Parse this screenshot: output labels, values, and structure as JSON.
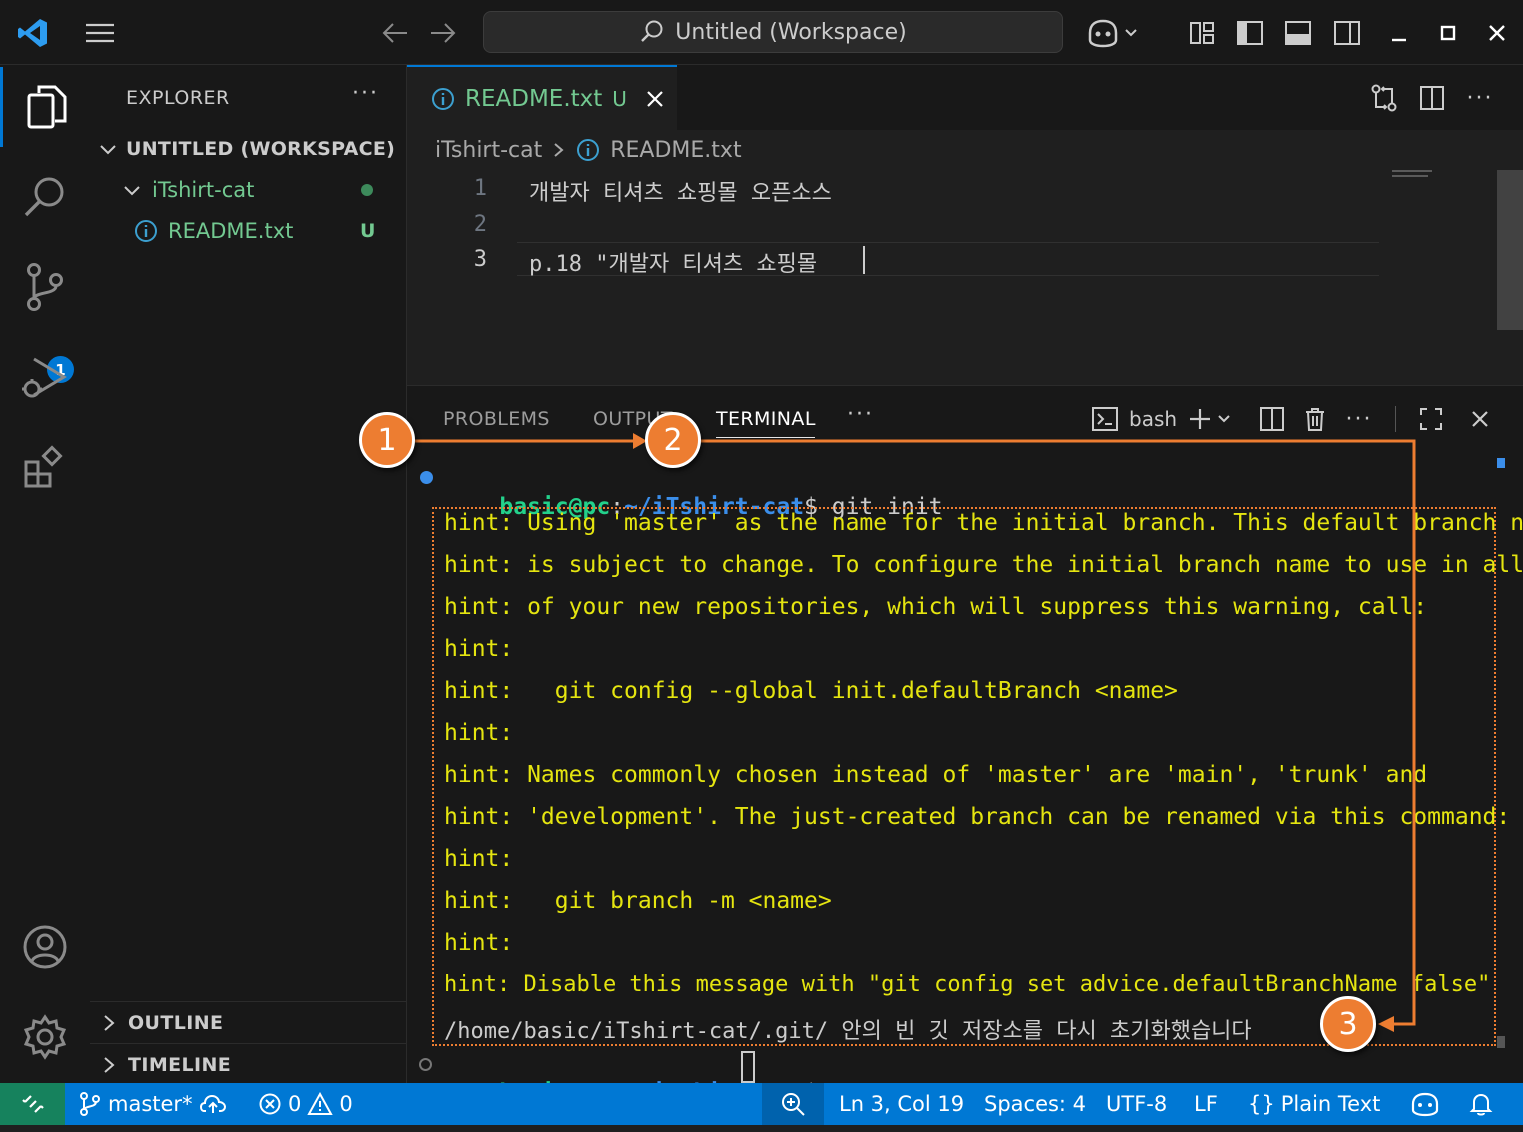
{
  "titlebar": {
    "search_text": "Untitled (Workspace)"
  },
  "activity": {
    "scm_badge": "1"
  },
  "sidebar": {
    "title": "EXPLORER",
    "more": "···",
    "workspace": "UNTITLED (WORKSPACE)",
    "folder": "iTshirt-cat",
    "file": "README.txt",
    "file_status": "U",
    "outline": "OUTLINE",
    "timeline": "TIMELINE"
  },
  "editor": {
    "tab_label": "README.txt",
    "tab_status": "U",
    "breadcrumb": [
      "iTshirt-cat",
      "README.txt"
    ],
    "lines": [
      {
        "no": "1",
        "text": "개발자 티셔츠 쇼핑몰 오픈소스"
      },
      {
        "no": "2",
        "text": ""
      },
      {
        "no": "3",
        "text": "p.18 \"개발자 티셔츠 쇼핑몰 "
      }
    ]
  },
  "panel": {
    "tabs": [
      "PROBLEMS",
      "OUTPUT",
      "TERMINAL"
    ],
    "active_tab": "TERMINAL",
    "shell": "bash",
    "terminal": {
      "prompt_user": "basic@pc",
      "prompt_path": "~/iTshirt-cat",
      "command": "$ git init",
      "hints": [
        "hint: Using 'master' as the name for the initial branch. This default branch name",
        "hint: is subject to change. To configure the initial branch name to use in all",
        "hint: of your new repositories, which will suppress this warning, call:",
        "hint:",
        "hint:   git config --global init.defaultBranch <name>",
        "hint:",
        "hint: Names commonly chosen instead of 'master' are 'main', 'trunk' and",
        "hint: 'development'. The just-created branch can be renamed via this command:",
        "hint:",
        "hint:   git branch -m <name>",
        "hint:",
        "hint: Disable this message with \"git config set advice.defaultBranchName false\""
      ],
      "result": "/home/basic/iTshirt-cat/.git/ 안의 빈 깃 저장소를 다시 초기화했습니다",
      "prompt_end": "$"
    }
  },
  "status": {
    "branch": "master*",
    "errors": "0",
    "warnings": "0",
    "position": "Ln 3, Col 19",
    "spaces": "Spaces: 4",
    "encoding": "UTF-8",
    "eol": "LF",
    "language": "Plain Text"
  },
  "callouts": [
    "1",
    "2",
    "3"
  ],
  "colors": {
    "accent": "#0078d4",
    "callout": "#ed7d31",
    "hint_text": "#e5e510",
    "untracked": "#73c991"
  }
}
